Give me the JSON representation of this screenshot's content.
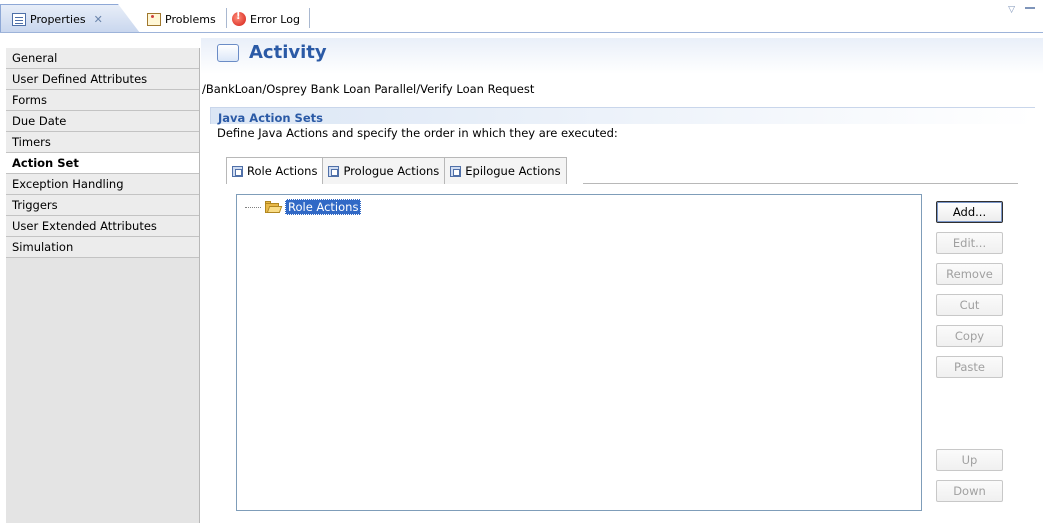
{
  "view_tabs": {
    "properties": "Properties",
    "properties_close": "✕",
    "problems": "Problems",
    "error_log": "Error Log",
    "view_menu": "▽"
  },
  "sidebar": {
    "items": [
      {
        "label": "General",
        "selected": false
      },
      {
        "label": "User Defined Attributes",
        "selected": false
      },
      {
        "label": "Forms",
        "selected": false
      },
      {
        "label": "Due Date",
        "selected": false
      },
      {
        "label": "Timers",
        "selected": false
      },
      {
        "label": "Action Set",
        "selected": true
      },
      {
        "label": "Exception Handling",
        "selected": false
      },
      {
        "label": "Triggers",
        "selected": false
      },
      {
        "label": "User Extended Attributes",
        "selected": false
      },
      {
        "label": "Simulation",
        "selected": false
      }
    ]
  },
  "header": {
    "title": "Activity",
    "path": "/BankLoan/Osprey Bank Loan Parallel/Verify Loan Request"
  },
  "section": {
    "title": "Java Action Sets",
    "description": "Define Java Actions and specify the order in which they are executed:"
  },
  "subtabs": [
    {
      "label": "Role Actions",
      "active": true
    },
    {
      "label": "Prologue Actions",
      "active": false
    },
    {
      "label": "Epilogue Actions",
      "active": false
    }
  ],
  "tree": {
    "root_label": "Role Actions"
  },
  "buttons": {
    "add": "Add...",
    "edit": "Edit...",
    "remove": "Remove",
    "cut": "Cut",
    "copy": "Copy",
    "paste": "Paste",
    "up": "Up",
    "down": "Down"
  },
  "colors": {
    "accent": "#2b5aa6",
    "selection": "#3169c6"
  }
}
